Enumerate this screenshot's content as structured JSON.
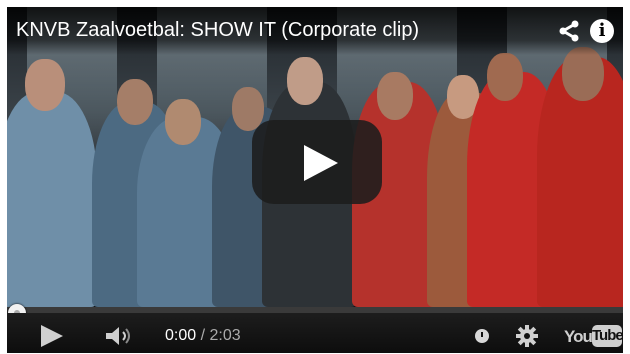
{
  "video": {
    "title": "KNVB Zaalvoetbal: SHOW IT (Corporate clip)"
  },
  "top_icons": {
    "share": "share-icon",
    "info": "info-icon",
    "info_glyph": "i"
  },
  "playback": {
    "progress_fraction": 0.0,
    "current_time": "0:00",
    "separator": " / ",
    "duration": "2:03"
  },
  "controls": {
    "play": "play-icon",
    "volume": "volume-icon",
    "watch_later": "clock-icon",
    "settings": "gear-icon"
  },
  "branding": {
    "logo_you": "You",
    "logo_tube": "Tube"
  },
  "colors": {
    "player_bg": "#000000",
    "jersey_red": "#c42a26",
    "jersey_blue": "#5f86a8",
    "big_play_bg": "#1c1c1c"
  }
}
